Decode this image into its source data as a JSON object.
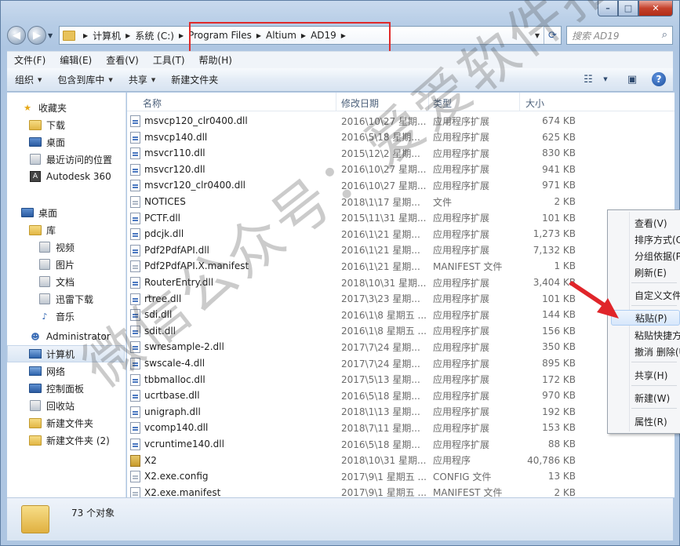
{
  "window": {
    "caption_buttons": {
      "min": "–",
      "max": "□",
      "close": "✕"
    }
  },
  "nav": {
    "back_icon": "back-arrow-icon",
    "forward_icon": "forward-arrow-icon"
  },
  "address": {
    "crumbs": [
      "计算机",
      "系统 (C:)",
      "Program Files",
      "Altium",
      "AD19"
    ]
  },
  "search": {
    "placeholder": "搜索 AD19"
  },
  "menubar": [
    "文件(F)",
    "编辑(E)",
    "查看(V)",
    "工具(T)",
    "帮助(H)"
  ],
  "toolbar": {
    "organize": "组织",
    "include_library": "包含到库中",
    "share": "共享",
    "new_folder": "新建文件夹"
  },
  "sidebar": {
    "favorites": "收藏夹",
    "favorites_items": [
      "下载",
      "桌面",
      "最近访问的位置",
      "Autodesk 360"
    ],
    "desktop": "桌面",
    "library": "库",
    "library_items": [
      "视频",
      "图片",
      "文档",
      "迅雷下载",
      "音乐"
    ],
    "desktop_items": [
      "Administrator",
      "计算机",
      "网络",
      "控制面板",
      "回收站",
      "新建文件夹",
      "新建文件夹 (2)"
    ]
  },
  "columns": {
    "name": "名称",
    "date": "修改日期",
    "type": "类型",
    "size": "大小"
  },
  "files": [
    {
      "name": "msvcp120_clr0400.dll",
      "date": "2016\\10\\27 星期...",
      "type": "应用程序扩展",
      "size": "674 KB",
      "icon": "dll"
    },
    {
      "name": "msvcp140.dll",
      "date": "2016\\5\\18 星期...",
      "type": "应用程序扩展",
      "size": "625 KB",
      "icon": "dll"
    },
    {
      "name": "msvcr110.dll",
      "date": "2015\\12\\2 星期...",
      "type": "应用程序扩展",
      "size": "830 KB",
      "icon": "dll"
    },
    {
      "name": "msvcr120.dll",
      "date": "2016\\10\\27 星期...",
      "type": "应用程序扩展",
      "size": "941 KB",
      "icon": "dll"
    },
    {
      "name": "msvcr120_clr0400.dll",
      "date": "2016\\10\\27 星期...",
      "type": "应用程序扩展",
      "size": "971 KB",
      "icon": "dll"
    },
    {
      "name": "NOTICES",
      "date": "2018\\1\\17 星期...",
      "type": "文件",
      "size": "2 KB",
      "icon": "doc"
    },
    {
      "name": "PCTF.dll",
      "date": "2015\\11\\31 星期...",
      "type": "应用程序扩展",
      "size": "101 KB",
      "icon": "dll"
    },
    {
      "name": "pdcjk.dll",
      "date": "2016\\1\\21 星期...",
      "type": "应用程序扩展",
      "size": "1,273 KB",
      "icon": "dll"
    },
    {
      "name": "Pdf2PdfAPI.dll",
      "date": "2016\\1\\21 星期...",
      "type": "应用程序扩展",
      "size": "7,132 KB",
      "icon": "dll"
    },
    {
      "name": "Pdf2PdfAPI.X.manifest",
      "date": "2016\\1\\21 星期...",
      "type": "MANIFEST 文件",
      "size": "1 KB",
      "icon": "doc"
    },
    {
      "name": "RouterEntry.dll",
      "date": "2018\\10\\31 星期...",
      "type": "应用程序扩展",
      "size": "3,404 KB",
      "icon": "dll"
    },
    {
      "name": "rtree.dll",
      "date": "2017\\3\\23 星期...",
      "type": "应用程序扩展",
      "size": "101 KB",
      "icon": "dll"
    },
    {
      "name": "sdi.dll",
      "date": "2016\\1\\8 星期五 ...",
      "type": "应用程序扩展",
      "size": "144 KB",
      "icon": "dll"
    },
    {
      "name": "sdit.dll",
      "date": "2016\\1\\8 星期五 ...",
      "type": "应用程序扩展",
      "size": "156 KB",
      "icon": "dll"
    },
    {
      "name": "swresample-2.dll",
      "date": "2017\\7\\24 星期...",
      "type": "应用程序扩展",
      "size": "350 KB",
      "icon": "dll"
    },
    {
      "name": "swscale-4.dll",
      "date": "2017\\7\\24 星期...",
      "type": "应用程序扩展",
      "size": "895 KB",
      "icon": "dll"
    },
    {
      "name": "tbbmalloc.dll",
      "date": "2017\\5\\13 星期...",
      "type": "应用程序扩展",
      "size": "172 KB",
      "icon": "dll"
    },
    {
      "name": "ucrtbase.dll",
      "date": "2016\\5\\18 星期...",
      "type": "应用程序扩展",
      "size": "970 KB",
      "icon": "dll"
    },
    {
      "name": "unigraph.dll",
      "date": "2018\\1\\13 星期...",
      "type": "应用程序扩展",
      "size": "192 KB",
      "icon": "dll"
    },
    {
      "name": "vcomp140.dll",
      "date": "2018\\7\\11 星期...",
      "type": "应用程序扩展",
      "size": "153 KB",
      "icon": "dll"
    },
    {
      "name": "vcruntime140.dll",
      "date": "2016\\5\\18 星期...",
      "type": "应用程序扩展",
      "size": "88 KB",
      "icon": "dll"
    },
    {
      "name": "X2",
      "date": "2018\\10\\31 星期...",
      "type": "应用程序",
      "size": "40,786 KB",
      "icon": "exe"
    },
    {
      "name": "X2.exe.config",
      "date": "2017\\9\\1 星期五 ...",
      "type": "CONFIG 文件",
      "size": "13 KB",
      "icon": "doc"
    },
    {
      "name": "X2.exe.manifest",
      "date": "2017\\9\\1 星期五 ...",
      "type": "MANIFEST 文件",
      "size": "2 KB",
      "icon": "doc"
    }
  ],
  "status": {
    "count": "73 个对象"
  },
  "context_menu": {
    "items": [
      "查看(V)",
      "排序方式(O)",
      "分组依据(P)",
      "刷新(E)",
      "自定义文件夹...",
      "粘贴(P)",
      "粘贴快捷方式(S)",
      "撤消 删除(U)",
      "共享(H)",
      "新建(W)",
      "属性(R)"
    ],
    "hovered": "粘贴(P)"
  },
  "watermark": "微信公众号：爱爱软件指南"
}
